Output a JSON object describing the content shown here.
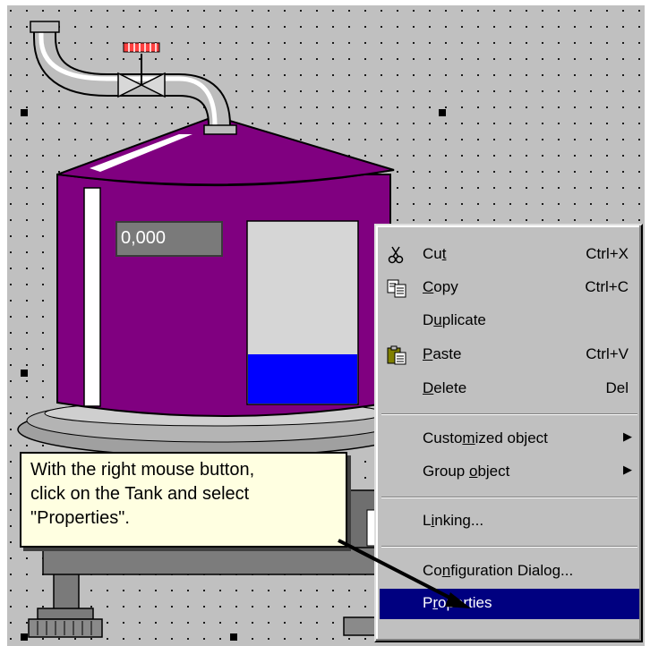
{
  "display": {
    "value": "0,000"
  },
  "menu": {
    "items": [
      {
        "label_before": "Cu",
        "accel": "t",
        "label_after": "",
        "shortcut": "Ctrl+X",
        "icon": "scissors-icon"
      },
      {
        "label_before": "",
        "accel": "C",
        "label_after": "opy",
        "shortcut": "Ctrl+C",
        "icon": "copy-icon"
      },
      {
        "label_before": "D",
        "accel": "u",
        "label_after": "plicate",
        "shortcut": "",
        "icon": ""
      },
      {
        "label_before": "",
        "accel": "P",
        "label_after": "aste",
        "shortcut": "Ctrl+V",
        "icon": "paste-icon"
      },
      {
        "label_before": "",
        "accel": "D",
        "label_after": "elete",
        "shortcut": "Del",
        "icon": ""
      },
      {
        "label_before": "Custo",
        "accel": "m",
        "label_after": "ized object",
        "shortcut": "",
        "submenu": true
      },
      {
        "label_before": "Group ",
        "accel": "o",
        "label_after": "bject",
        "shortcut": "",
        "submenu": true
      },
      {
        "label_before": "L",
        "accel": "i",
        "label_after": "nking...",
        "shortcut": ""
      },
      {
        "label_before": "Co",
        "accel": "n",
        "label_after": "figuration Dialog...",
        "shortcut": ""
      },
      {
        "label_before": "P",
        "accel": "r",
        "label_after": "operties",
        "shortcut": "",
        "selected": true
      }
    ],
    "submenu_arrow": "▶"
  },
  "tooltip": {
    "line1": "With the right mouse button,",
    "line2": "click on the Tank and select",
    "line3": "\"Properties\"."
  },
  "tank": {
    "body_color": "#800080",
    "level_fill_color": "#0000ff",
    "level_fraction": 0.27
  }
}
